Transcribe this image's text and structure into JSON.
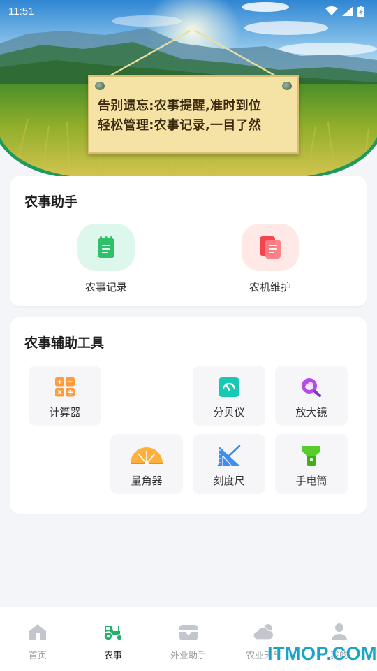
{
  "status_bar": {
    "time": "11:51"
  },
  "banner": {
    "line1": "告别遗忘:农事提醒,准时到位",
    "line2": "轻松管理:农事记录,一目了然"
  },
  "assistant": {
    "title": "农事助手",
    "items": [
      {
        "label": "农事记录",
        "icon": "notebook-icon",
        "color": "#31c46e"
      },
      {
        "label": "农机维护",
        "icon": "documents-icon",
        "color": "#f04a55"
      }
    ]
  },
  "tools": {
    "title": "农事辅助工具",
    "items": [
      {
        "label": "计算器",
        "icon": "calculator-icon"
      },
      {
        "label": "分贝仪",
        "icon": "decibel-meter-icon"
      },
      {
        "label": "放大镜",
        "icon": "magnifier-icon"
      },
      {
        "label": "量角器",
        "icon": "protractor-icon"
      },
      {
        "label": "刻度尺",
        "icon": "ruler-icon"
      },
      {
        "label": "手电筒",
        "icon": "flashlight-icon"
      }
    ]
  },
  "tabbar": {
    "active": "农事",
    "items": [
      {
        "label": "首页",
        "icon": "home-icon"
      },
      {
        "label": "农事",
        "icon": "tractor-icon"
      },
      {
        "label": "外业助手",
        "icon": "field-kit-icon"
      },
      {
        "label": "农业天气",
        "icon": "weather-icon"
      },
      {
        "label": "我的",
        "icon": "user-icon"
      }
    ]
  },
  "watermark": "ITMOP.COM",
  "colors": {
    "accent": "#2fb566",
    "background": "#f3f5f9",
    "watermark": "#1aa5c8"
  }
}
